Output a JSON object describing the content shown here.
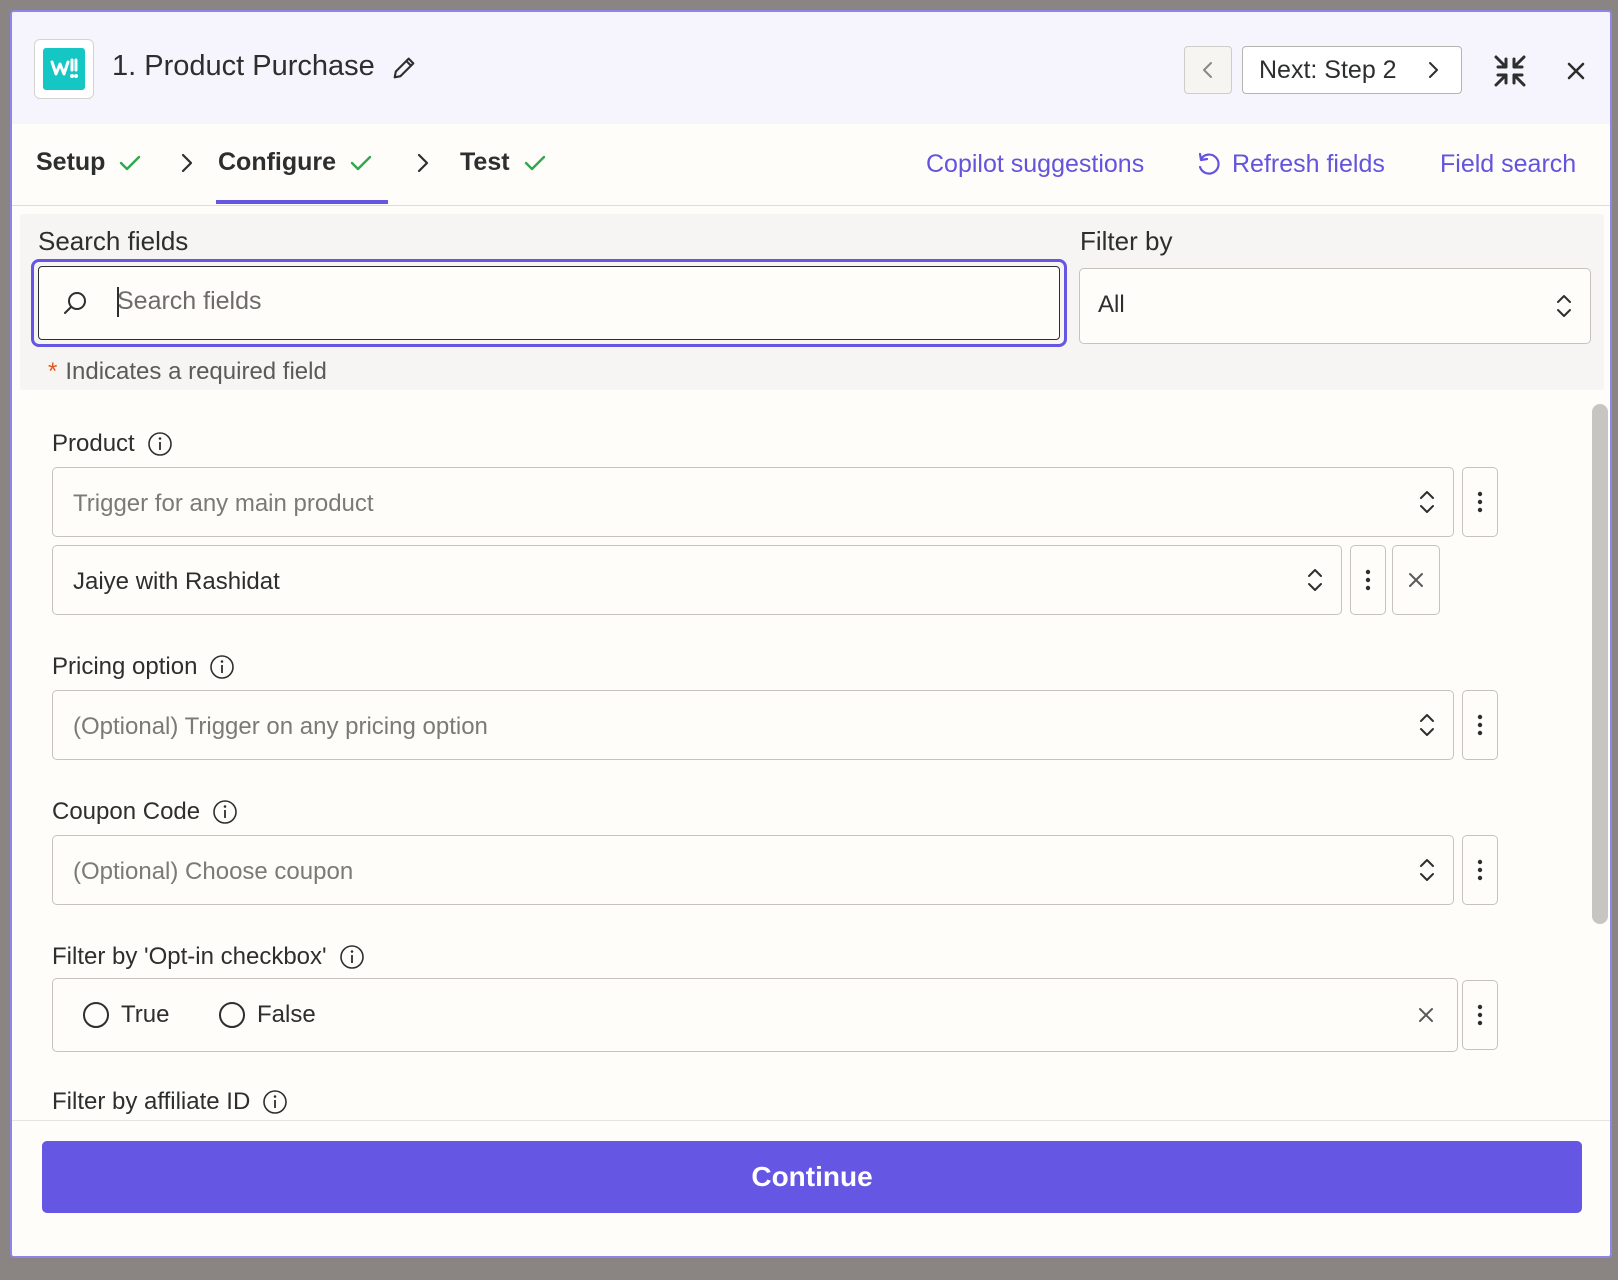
{
  "header": {
    "step_title": "1. Product Purchase",
    "next_label": "Next: Step 2"
  },
  "tabs": [
    {
      "label": "Setup",
      "status": "complete"
    },
    {
      "label": "Configure",
      "status": "complete",
      "active": true
    },
    {
      "label": "Test",
      "status": "complete"
    }
  ],
  "actions": {
    "copilot": "Copilot suggestions",
    "refresh": "Refresh fields",
    "field_search": "Field search"
  },
  "search": {
    "label": "Search fields",
    "placeholder": "Search fields",
    "filter_label": "Filter by",
    "filter_value": "All"
  },
  "required_note": "Indicates a required field",
  "fields": {
    "product": {
      "label": "Product",
      "placeholder": "Trigger for any main product",
      "selected": "Jaiye with Rashidat"
    },
    "pricing": {
      "label": "Pricing option",
      "placeholder": "(Optional) Trigger on any pricing option"
    },
    "coupon": {
      "label": "Coupon Code",
      "placeholder": "(Optional) Choose coupon"
    },
    "optin": {
      "label": "Filter by 'Opt-in checkbox'",
      "options": [
        "True",
        "False"
      ]
    },
    "affiliate": {
      "label": "Filter by affiliate ID"
    }
  },
  "footer": {
    "continue_label": "Continue"
  },
  "colors": {
    "accent": "#6556e4",
    "success": "#2fa84f",
    "brand_teal": "#14c7c4"
  }
}
